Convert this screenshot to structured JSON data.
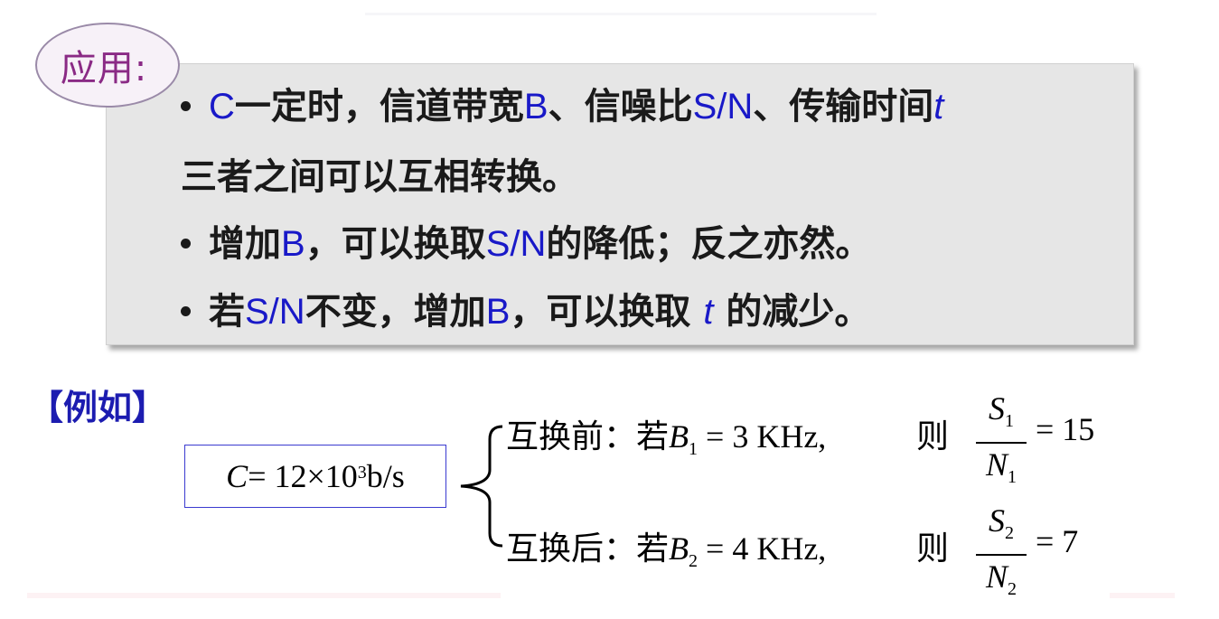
{
  "badge": {
    "label": "应用:"
  },
  "box": {
    "line1": {
      "c": "C",
      "t1": "一定时，信道带宽",
      "b": "B",
      "t2": "、信噪比",
      "sn": "S/N",
      "t3": "、传输时间",
      "t": "t"
    },
    "line2": {
      "text": "三者之间可以互相转换。"
    },
    "line3": {
      "t1": "增加",
      "b": "B",
      "t2": "，可以换取",
      "sn": "S/N",
      "t3": "的降低；反之亦然。"
    },
    "line4": {
      "t1": "若",
      "sn": "S/N",
      "t2": "不变，增加",
      "b": "B",
      "t3": "，可以换取 ",
      "t": "t",
      "t4": " 的减少。"
    }
  },
  "example": {
    "label": "【例如】",
    "formula": {
      "c": "C",
      "eq": " = 12×10",
      "exp": "3",
      "unit": " b/s"
    },
    "before": {
      "prefix": "互换前：若",
      "b": "B",
      "sub": "1",
      "value": " = 3 KHz,",
      "then": "则",
      "num": "S",
      "num_sub": "1",
      "den": "N",
      "den_sub": "1",
      "result": "= 15"
    },
    "after": {
      "prefix": "互换后：若",
      "b": "B",
      "sub": "2",
      "value": " = 4 KHz,",
      "then": "则",
      "num": "S",
      "num_sub": "2",
      "den": "N",
      "den_sub": "2",
      "result": "= 7"
    }
  },
  "colors": {
    "accent_blue": "#1919c8",
    "badge_text": "#8a2a85",
    "box_bg": "#e6e6e6"
  },
  "icons": {
    "bullet": "bullet-dot-icon",
    "brace": "left-brace-icon"
  }
}
